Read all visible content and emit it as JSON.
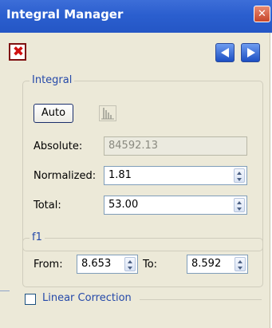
{
  "window": {
    "title": "Integral Manager"
  },
  "toolbar": {
    "delete_icon": "delete-x-icon",
    "prev_icon": "arrow-left-icon",
    "next_icon": "arrow-right-icon"
  },
  "integral": {
    "legend": "Integral",
    "auto_label": "Auto",
    "histogram_icon": "histogram-icon",
    "absolute_label": "Absolute:",
    "absolute_value": "84592.13",
    "normalized_label": "Normalized:",
    "normalized_value": "1.81",
    "total_label": "Total:",
    "total_value": "53.00"
  },
  "f1": {
    "legend": "f1",
    "from_label": "From:",
    "from_value": "8.653",
    "to_label": "To:",
    "to_value": "8.592"
  },
  "linear_correction": {
    "label": "Linear Correction",
    "checked": false
  },
  "colors": {
    "title_bar": "#2456c5",
    "panel_bg": "#ece9d8",
    "legend_text": "#2549a9",
    "close_red": "#c6462a"
  }
}
